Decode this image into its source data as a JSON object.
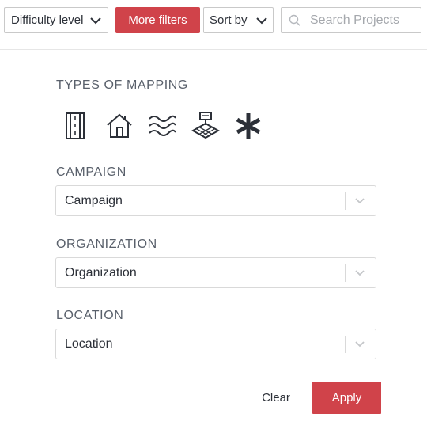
{
  "toolbar": {
    "difficulty_label": "Difficulty level",
    "more_filters_label": "More filters",
    "sort_label": "Sort by",
    "search_placeholder": "Search Projects"
  },
  "filters": {
    "types_title": "TYPES OF MAPPING",
    "mapping_types": [
      {
        "icon": "roads-icon"
      },
      {
        "icon": "buildings-icon"
      },
      {
        "icon": "waterways-icon"
      },
      {
        "icon": "land-use-icon"
      },
      {
        "icon": "other-icon"
      }
    ],
    "campaign": {
      "title": "CAMPAIGN",
      "value": "Campaign"
    },
    "organization": {
      "title": "ORGANIZATION",
      "value": "Organization"
    },
    "location": {
      "title": "LOCATION",
      "value": "Location"
    }
  },
  "actions": {
    "clear_label": "Clear",
    "apply_label": "Apply"
  },
  "colors": {
    "accent": "#d0434a",
    "section_title": "#59606b",
    "border": "#d9d9d9"
  }
}
